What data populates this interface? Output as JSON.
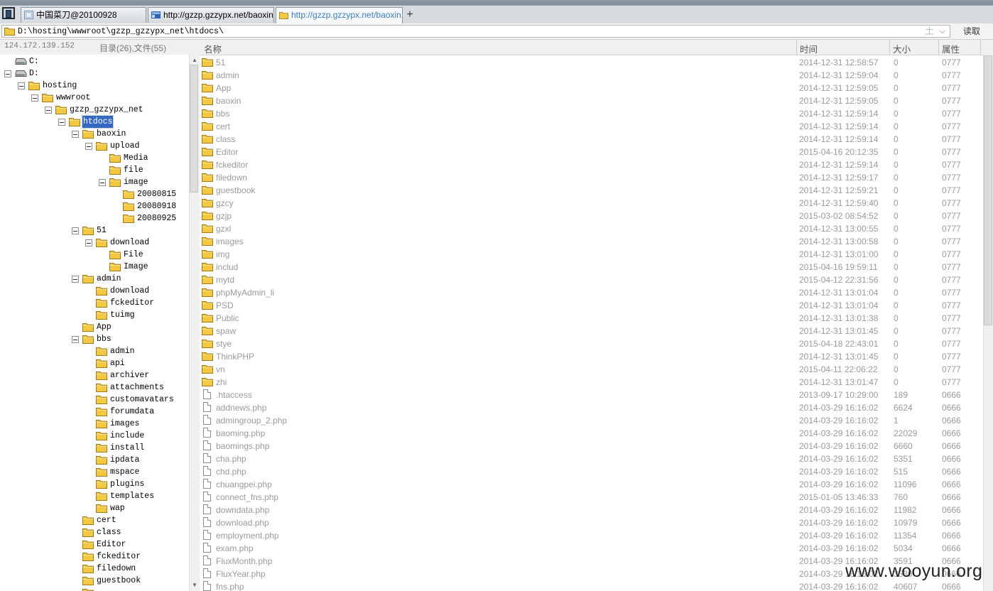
{
  "colors": {
    "accent": "#3568c0",
    "folder": "#f3c944",
    "active_tab_text": "#3d7fb8"
  },
  "tabs": [
    {
      "title": "中国菜刀@20100928"
    },
    {
      "title": "http://gzzp.gzzypx.net/baoxin..."
    },
    {
      "title": "http://gzzp.gzzypx.net/baoxin..."
    }
  ],
  "new_tab_label": "+",
  "address": {
    "path": "D:\\hosting\\wwwroot\\gzzp_gzzypx_net\\htdocs\\",
    "up_glyph": "土",
    "read_label": "读取"
  },
  "status": {
    "ip": "124.172.139.152",
    "counts": "目录(26),文件(55)"
  },
  "columns": {
    "name": "名称",
    "time": "时间",
    "size": "大小",
    "attr": "属性"
  },
  "tree": [
    {
      "label": "C:",
      "level": 0,
      "type": "drive",
      "toggle": "none"
    },
    {
      "label": "D:",
      "level": 0,
      "type": "drive",
      "toggle": "minus"
    },
    {
      "label": "hosting",
      "level": 1,
      "type": "folder",
      "toggle": "minus"
    },
    {
      "label": "wwwroot",
      "level": 2,
      "type": "folder",
      "toggle": "minus"
    },
    {
      "label": "gzzp_gzzypx_net",
      "level": 3,
      "type": "folder",
      "toggle": "minus"
    },
    {
      "label": "htdocs",
      "level": 4,
      "type": "folder",
      "toggle": "minus",
      "selected": true
    },
    {
      "label": "baoxin",
      "level": 5,
      "type": "folder",
      "toggle": "minus"
    },
    {
      "label": "upload",
      "level": 6,
      "type": "folder",
      "toggle": "minus"
    },
    {
      "label": "Media",
      "level": 7,
      "type": "folder",
      "toggle": "none"
    },
    {
      "label": "file",
      "level": 7,
      "type": "folder",
      "toggle": "none"
    },
    {
      "label": "image",
      "level": 7,
      "type": "folder",
      "toggle": "minus"
    },
    {
      "label": "20080815",
      "level": 8,
      "type": "folder",
      "toggle": "none"
    },
    {
      "label": "20080918",
      "level": 8,
      "type": "folder",
      "toggle": "none"
    },
    {
      "label": "20080925",
      "level": 8,
      "type": "folder",
      "toggle": "none"
    },
    {
      "label": "51",
      "level": 5,
      "type": "folder",
      "toggle": "minus"
    },
    {
      "label": "download",
      "level": 6,
      "type": "folder",
      "toggle": "minus"
    },
    {
      "label": "File",
      "level": 7,
      "type": "folder",
      "toggle": "none"
    },
    {
      "label": "Image",
      "level": 7,
      "type": "folder",
      "toggle": "none"
    },
    {
      "label": "admin",
      "level": 5,
      "type": "folder",
      "toggle": "minus"
    },
    {
      "label": "download",
      "level": 6,
      "type": "folder",
      "toggle": "none"
    },
    {
      "label": "fckeditor",
      "level": 6,
      "type": "folder",
      "toggle": "none"
    },
    {
      "label": "tuimg",
      "level": 6,
      "type": "folder",
      "toggle": "none"
    },
    {
      "label": "App",
      "level": 5,
      "type": "folder",
      "toggle": "none"
    },
    {
      "label": "bbs",
      "level": 5,
      "type": "folder",
      "toggle": "minus"
    },
    {
      "label": "admin",
      "level": 6,
      "type": "folder",
      "toggle": "none"
    },
    {
      "label": "api",
      "level": 6,
      "type": "folder",
      "toggle": "none"
    },
    {
      "label": "archiver",
      "level": 6,
      "type": "folder",
      "toggle": "none"
    },
    {
      "label": "attachments",
      "level": 6,
      "type": "folder",
      "toggle": "none"
    },
    {
      "label": "customavatars",
      "level": 6,
      "type": "folder",
      "toggle": "none"
    },
    {
      "label": "forumdata",
      "level": 6,
      "type": "folder",
      "toggle": "none"
    },
    {
      "label": "images",
      "level": 6,
      "type": "folder",
      "toggle": "none"
    },
    {
      "label": "include",
      "level": 6,
      "type": "folder",
      "toggle": "none"
    },
    {
      "label": "install",
      "level": 6,
      "type": "folder",
      "toggle": "none"
    },
    {
      "label": "ipdata",
      "level": 6,
      "type": "folder",
      "toggle": "none"
    },
    {
      "label": "mspace",
      "level": 6,
      "type": "folder",
      "toggle": "none"
    },
    {
      "label": "plugins",
      "level": 6,
      "type": "folder",
      "toggle": "none"
    },
    {
      "label": "templates",
      "level": 6,
      "type": "folder",
      "toggle": "none"
    },
    {
      "label": "wap",
      "level": 6,
      "type": "folder",
      "toggle": "none"
    },
    {
      "label": "cert",
      "level": 5,
      "type": "folder",
      "toggle": "none"
    },
    {
      "label": "class",
      "level": 5,
      "type": "folder",
      "toggle": "none"
    },
    {
      "label": "Editor",
      "level": 5,
      "type": "folder",
      "toggle": "none"
    },
    {
      "label": "fckeditor",
      "level": 5,
      "type": "folder",
      "toggle": "none"
    },
    {
      "label": "filedown",
      "level": 5,
      "type": "folder",
      "toggle": "none"
    },
    {
      "label": "guestbook",
      "level": 5,
      "type": "folder",
      "toggle": "none"
    },
    {
      "label": "",
      "level": 5,
      "type": "folder",
      "toggle": "none"
    }
  ],
  "files": [
    {
      "name": "51",
      "time": "2014-12-31 12:58:57",
      "size": "0",
      "attr": "0777",
      "type": "folder"
    },
    {
      "name": "admin",
      "time": "2014-12-31 12:59:04",
      "size": "0",
      "attr": "0777",
      "type": "folder"
    },
    {
      "name": "App",
      "time": "2014-12-31 12:59:05",
      "size": "0",
      "attr": "0777",
      "type": "folder"
    },
    {
      "name": "baoxin",
      "time": "2014-12-31 12:59:05",
      "size": "0",
      "attr": "0777",
      "type": "folder"
    },
    {
      "name": "bbs",
      "time": "2014-12-31 12:59:14",
      "size": "0",
      "attr": "0777",
      "type": "folder"
    },
    {
      "name": "cert",
      "time": "2014-12-31 12:59:14",
      "size": "0",
      "attr": "0777",
      "type": "folder"
    },
    {
      "name": "class",
      "time": "2014-12-31 12:59:14",
      "size": "0",
      "attr": "0777",
      "type": "folder"
    },
    {
      "name": "Editor",
      "time": "2015-04-16 20:12:35",
      "size": "0",
      "attr": "0777",
      "type": "folder"
    },
    {
      "name": "fckeditor",
      "time": "2014-12-31 12:59:14",
      "size": "0",
      "attr": "0777",
      "type": "folder"
    },
    {
      "name": "filedown",
      "time": "2014-12-31 12:59:17",
      "size": "0",
      "attr": "0777",
      "type": "folder"
    },
    {
      "name": "guestbook",
      "time": "2014-12-31 12:59:21",
      "size": "0",
      "attr": "0777",
      "type": "folder"
    },
    {
      "name": "gzcy",
      "time": "2014-12-31 12:59:40",
      "size": "0",
      "attr": "0777",
      "type": "folder"
    },
    {
      "name": "gzjp",
      "time": "2015-03-02 08:54:52",
      "size": "0",
      "attr": "0777",
      "type": "folder"
    },
    {
      "name": "gzxl",
      "time": "2014-12-31 13:00:55",
      "size": "0",
      "attr": "0777",
      "type": "folder"
    },
    {
      "name": "images",
      "time": "2014-12-31 13:00:58",
      "size": "0",
      "attr": "0777",
      "type": "folder"
    },
    {
      "name": "img",
      "time": "2014-12-31 13:01:00",
      "size": "0",
      "attr": "0777",
      "type": "folder"
    },
    {
      "name": "includ",
      "time": "2015-04-16 19:59:11",
      "size": "0",
      "attr": "0777",
      "type": "folder"
    },
    {
      "name": "mytd",
      "time": "2015-04-12 22:31:56",
      "size": "0",
      "attr": "0777",
      "type": "folder"
    },
    {
      "name": "phpMyAdmin_li",
      "time": "2014-12-31 13:01:04",
      "size": "0",
      "attr": "0777",
      "type": "folder"
    },
    {
      "name": "PSD",
      "time": "2014-12-31 13:01:04",
      "size": "0",
      "attr": "0777",
      "type": "folder"
    },
    {
      "name": "Public",
      "time": "2014-12-31 13:01:38",
      "size": "0",
      "attr": "0777",
      "type": "folder"
    },
    {
      "name": "spaw",
      "time": "2014-12-31 13:01:45",
      "size": "0",
      "attr": "0777",
      "type": "folder"
    },
    {
      "name": "stye",
      "time": "2015-04-18 22:43:01",
      "size": "0",
      "attr": "0777",
      "type": "folder"
    },
    {
      "name": "ThinkPHP",
      "time": "2014-12-31 13:01:45",
      "size": "0",
      "attr": "0777",
      "type": "folder"
    },
    {
      "name": "vn",
      "time": "2015-04-11 22:06:22",
      "size": "0",
      "attr": "0777",
      "type": "folder"
    },
    {
      "name": "zhi",
      "time": "2014-12-31 13:01:47",
      "size": "0",
      "attr": "0777",
      "type": "folder"
    },
    {
      "name": ".htaccess",
      "time": "2013-09-17 10:29:00",
      "size": "189",
      "attr": "0666",
      "type": "file"
    },
    {
      "name": "addnews.php",
      "time": "2014-03-29 16:16:02",
      "size": "6624",
      "attr": "0666",
      "type": "file"
    },
    {
      "name": "admingroup_2.php",
      "time": "2014-03-29 16:16:02",
      "size": "1",
      "attr": "0666",
      "type": "file"
    },
    {
      "name": "baoming.php",
      "time": "2014-03-29 16:16:02",
      "size": "22029",
      "attr": "0666",
      "type": "file"
    },
    {
      "name": "baomings.php",
      "time": "2014-03-29 16:16:02",
      "size": "6660",
      "attr": "0666",
      "type": "file"
    },
    {
      "name": "cha.php",
      "time": "2014-03-29 16:16:02",
      "size": "5351",
      "attr": "0666",
      "type": "file"
    },
    {
      "name": "chd.php",
      "time": "2014-03-29 16:16:02",
      "size": "515",
      "attr": "0666",
      "type": "file"
    },
    {
      "name": "chuangpei.php",
      "time": "2014-03-29 16:16:02",
      "size": "11096",
      "attr": "0666",
      "type": "file"
    },
    {
      "name": "connect_fns.php",
      "time": "2015-01-05 13:46:33",
      "size": "760",
      "attr": "0666",
      "type": "file"
    },
    {
      "name": "downdata.php",
      "time": "2014-03-29 16:16:02",
      "size": "11982",
      "attr": "0666",
      "type": "file"
    },
    {
      "name": "download.php",
      "time": "2014-03-29 16:16:02",
      "size": "10979",
      "attr": "0666",
      "type": "file"
    },
    {
      "name": "employment.php",
      "time": "2014-03-29 16:16:02",
      "size": "11354",
      "attr": "0666",
      "type": "file"
    },
    {
      "name": "exam.php",
      "time": "2014-03-29 16:16:02",
      "size": "5034",
      "attr": "0666",
      "type": "file"
    },
    {
      "name": "FluxMonth.php",
      "time": "2014-03-29 16:16:02",
      "size": "3591",
      "attr": "0666",
      "type": "file"
    },
    {
      "name": "FluxYear.php",
      "time": "2014-03-29 16:16:02",
      "size": "3530",
      "attr": "0666",
      "type": "file"
    },
    {
      "name": "fns.php",
      "time": "2014-03-29 16:16:02",
      "size": "40607",
      "attr": "0666",
      "type": "file"
    }
  ],
  "watermark": "www.wooyun.org"
}
